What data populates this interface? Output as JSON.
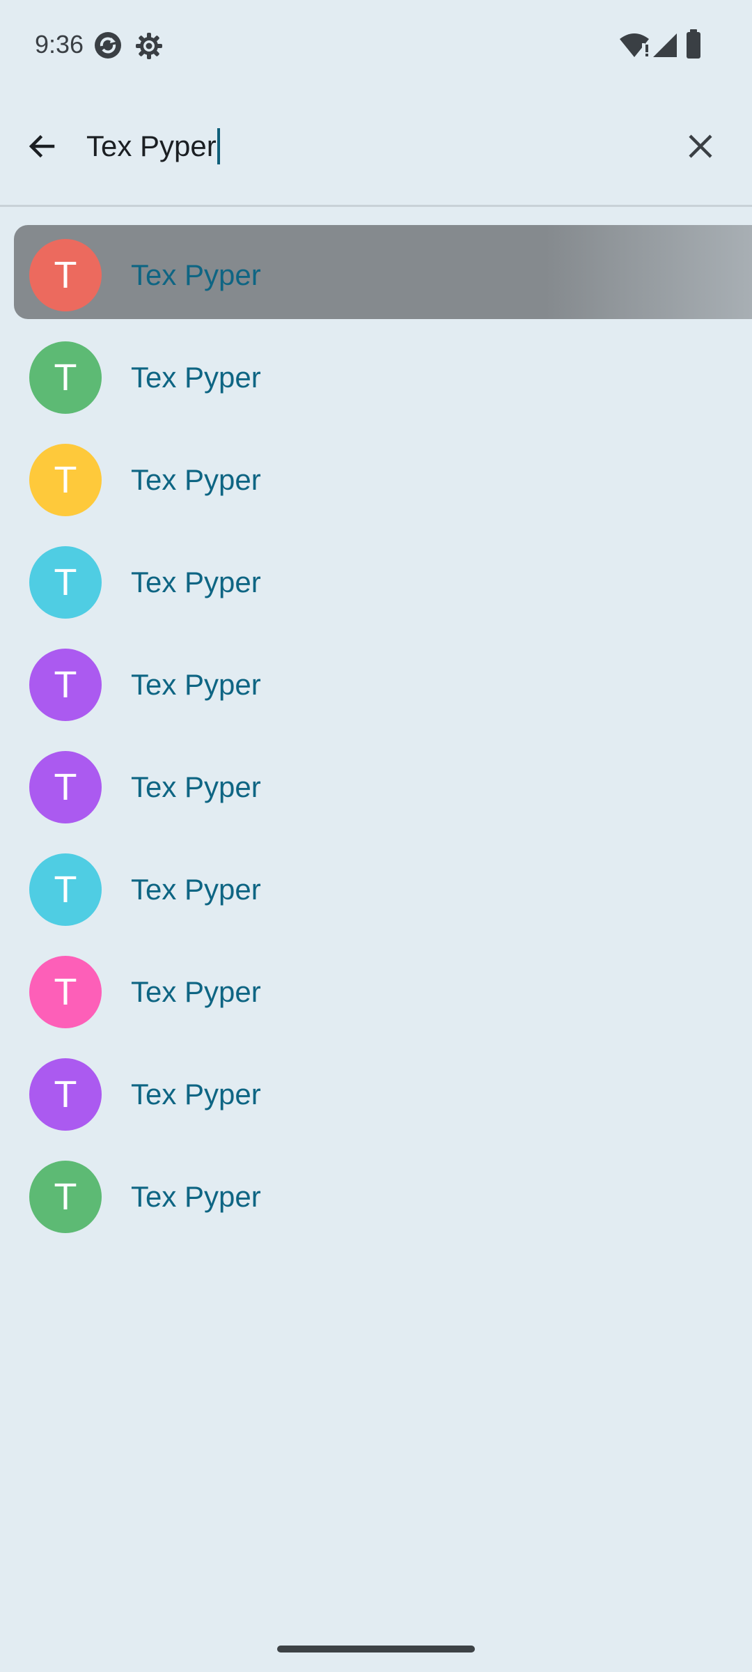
{
  "status_bar": {
    "time": "9:36",
    "left_icons": [
      "sync-app-icon",
      "settings-gear-icon"
    ],
    "right_icons": [
      "wifi-alert-icon",
      "cellular-signal-icon",
      "battery-icon"
    ]
  },
  "search": {
    "value": "Tex Pyper",
    "back_icon": "arrow-back-icon",
    "clear_icon": "close-icon"
  },
  "results": [
    {
      "initial": "T",
      "name": "Tex Pyper",
      "color": "#ec6a5e",
      "selected": true
    },
    {
      "initial": "T",
      "name": "Tex Pyper",
      "color": "#5dba74",
      "selected": false
    },
    {
      "initial": "T",
      "name": "Tex Pyper",
      "color": "#fec93b",
      "selected": false
    },
    {
      "initial": "T",
      "name": "Tex Pyper",
      "color": "#4fcde3",
      "selected": false
    },
    {
      "initial": "T",
      "name": "Tex Pyper",
      "color": "#ab5af0",
      "selected": false
    },
    {
      "initial": "T",
      "name": "Tex Pyper",
      "color": "#ab5af0",
      "selected": false
    },
    {
      "initial": "T",
      "name": "Tex Pyper",
      "color": "#4fcde3",
      "selected": false
    },
    {
      "initial": "T",
      "name": "Tex Pyper",
      "color": "#fd5fb8",
      "selected": false
    },
    {
      "initial": "T",
      "name": "Tex Pyper",
      "color": "#ab5af0",
      "selected": false
    },
    {
      "initial": "T",
      "name": "Tex Pyper",
      "color": "#5dba74",
      "selected": false
    }
  ],
  "colors": {
    "background": "#e2ecf2",
    "name_text": "#0e6583",
    "caret": "#0f5f7a"
  }
}
